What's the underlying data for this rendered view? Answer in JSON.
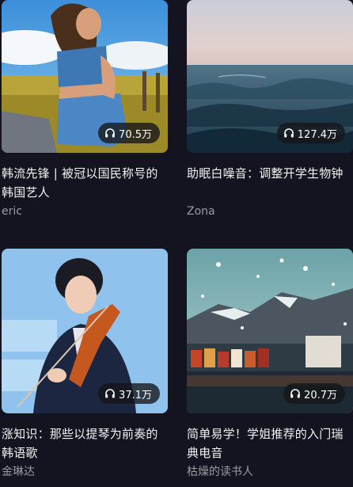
{
  "cards": [
    {
      "title": "韩流先锋 | 被冠以国民称号的韩国艺人",
      "author": "eric",
      "plays": "70.5万"
    },
    {
      "title": "助眠白噪音：调整开学生物钟",
      "author": "Zona",
      "plays": "127.4万"
    },
    {
      "title": "涨知识：那些以提琴为前奏的韩语歌",
      "author": "金琳达",
      "plays": "37.1万"
    },
    {
      "title": "简单易学！学姐推荐的入门瑞典电音",
      "author": "枯燥的读书人",
      "plays": "20.7万"
    }
  ],
  "icons": {
    "play_count": "headphones-icon"
  }
}
